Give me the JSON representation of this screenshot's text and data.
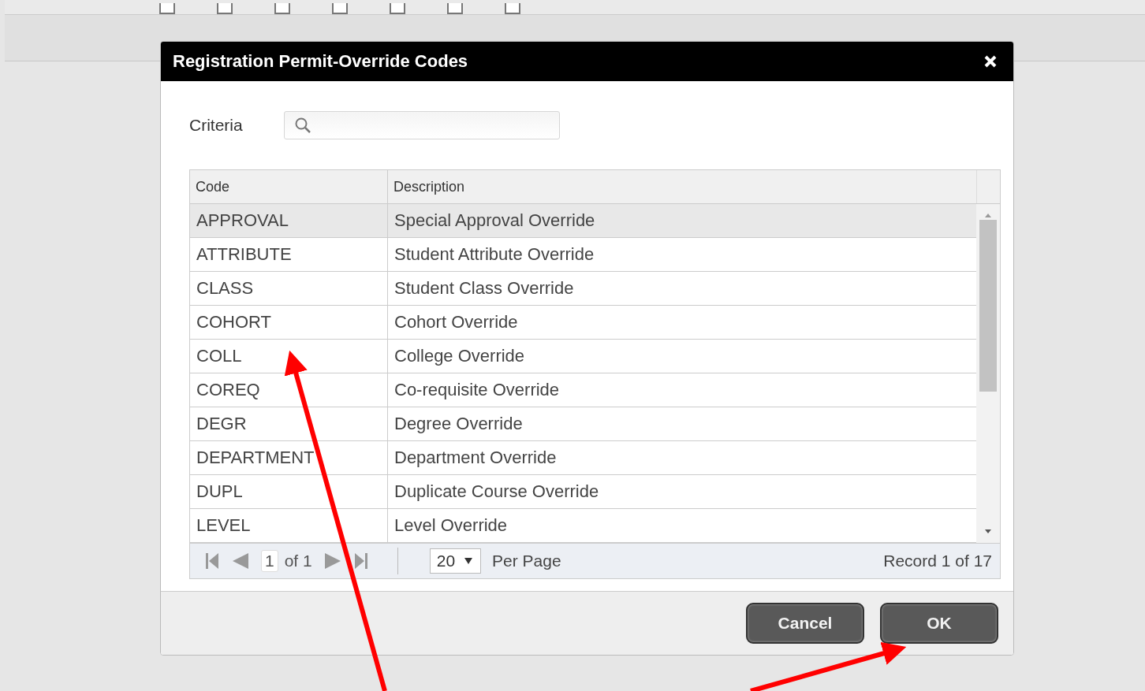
{
  "background": {
    "checkboxes": [
      {
        "checked": false
      },
      {
        "checked": false
      },
      {
        "checked": false
      },
      {
        "checked": false
      },
      {
        "checked": false
      },
      {
        "checked": false
      },
      {
        "checked": false
      }
    ]
  },
  "dialog": {
    "title": "Registration Permit-Override Codes",
    "criteria": {
      "label": "Criteria"
    },
    "table": {
      "columns": [
        "Code",
        "Description"
      ],
      "rows": [
        {
          "code": "APPROVAL",
          "description": "Special Approval Override",
          "selected": true
        },
        {
          "code": "ATTRIBUTE",
          "description": "Student Attribute Override",
          "selected": false
        },
        {
          "code": "CLASS",
          "description": "Student Class Override",
          "selected": false
        },
        {
          "code": "COHORT",
          "description": "Cohort Override",
          "selected": false
        },
        {
          "code": "COLL",
          "description": "College Override",
          "selected": false
        },
        {
          "code": "COREQ",
          "description": "Co-requisite Override",
          "selected": false
        },
        {
          "code": "DEGR",
          "description": "Degree Override",
          "selected": false
        },
        {
          "code": "DEPARTMENT",
          "description": "Department Override",
          "selected": false
        },
        {
          "code": "DUPL",
          "description": "Duplicate Course Override",
          "selected": false
        },
        {
          "code": "LEVEL",
          "description": "Level Override",
          "selected": false
        }
      ]
    },
    "pager": {
      "page": "1",
      "of": "of 1",
      "per_page": "20",
      "per_page_label": "Per Page",
      "record": "Record 1 of 17"
    },
    "buttons": [
      "Cancel",
      "OK"
    ]
  }
}
